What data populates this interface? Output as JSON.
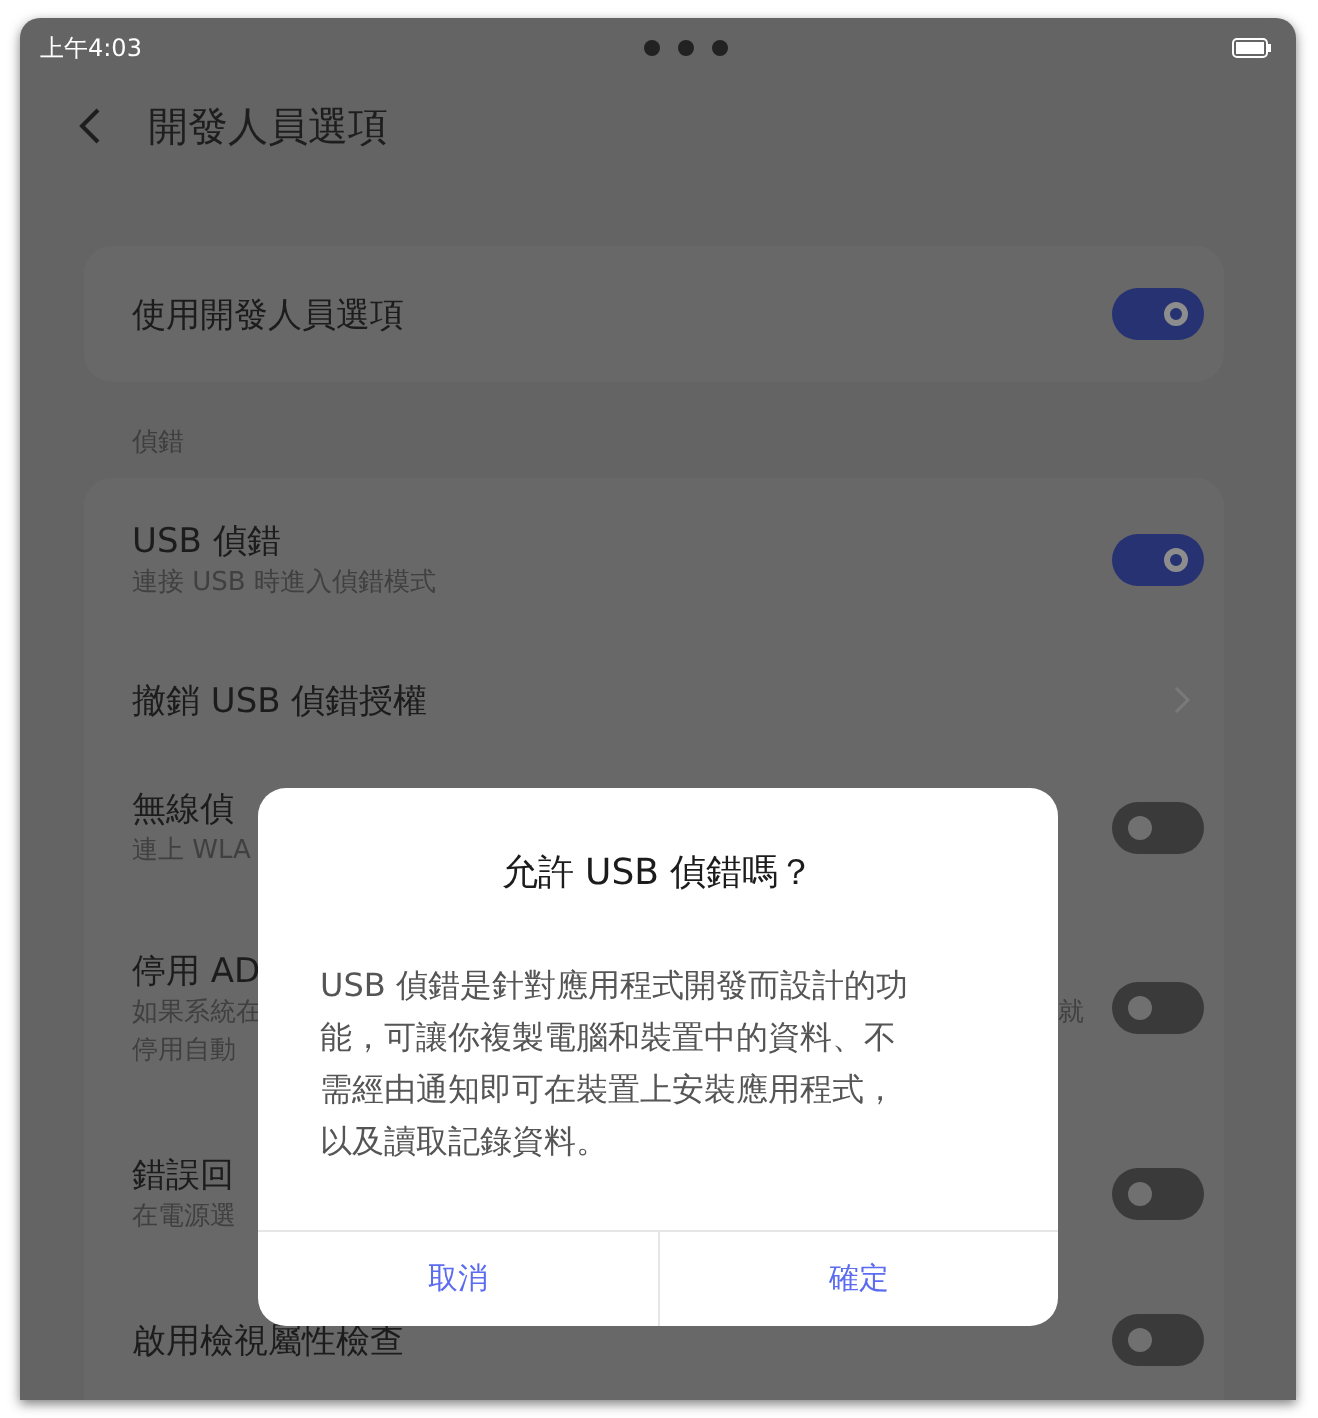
{
  "status_bar": {
    "time": "上午4:03"
  },
  "header": {
    "title": "開發人員選項"
  },
  "master": {
    "label": "使用開發人員選項",
    "on": true
  },
  "section": {
    "label": "偵錯"
  },
  "rows": [
    {
      "kind": "toggle",
      "label": "USB 偵錯",
      "lines": [
        "連接 USB 時進入偵錯模式"
      ],
      "on": true
    },
    {
      "kind": "link",
      "label": "撤銷 USB 偵錯授權"
    },
    {
      "kind": "toggle",
      "label": "無線偵",
      "lines": [
        "連上 WLA"
      ],
      "on": false
    },
    {
      "kind": "toggle",
      "label": "停用 AD",
      "lines": [
        "如果系統在",
        "停用自動"
      ],
      "tail": "就",
      "on": false
    },
    {
      "kind": "toggle",
      "label": "錯誤回",
      "lines": [
        "在電源選"
      ],
      "on": false
    },
    {
      "kind": "toggle",
      "label": "啟用檢視屬性檢查",
      "on": false
    }
  ],
  "dialog": {
    "title": "允許 USB 偵錯嗎？",
    "body_lines": [
      "USB 偵錯是針對應用程式開發而設計的功",
      "能，可讓你複製電腦和裝置中的資料、不",
      "需經由通知即可在裝置上安裝應用程式，",
      "以及讀取記錄資料。"
    ],
    "buttons": [
      "取消",
      "確定"
    ]
  }
}
